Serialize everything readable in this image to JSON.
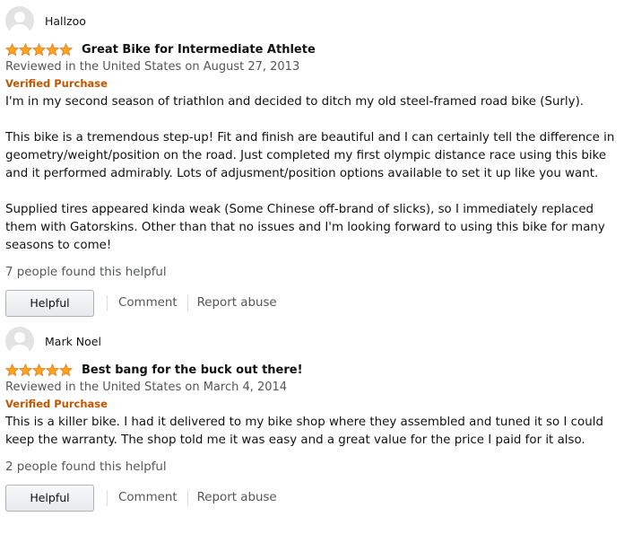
{
  "colors": {
    "star": "#ffa41c",
    "verified": "#c45500",
    "meta_text": "#555555"
  },
  "reviews": [
    {
      "author": "Hallzoo",
      "avatar_icon": "default-avatar-icon",
      "rating": 5,
      "title": "Great Bike for Intermediate Athlete",
      "date": "Reviewed in the United States on August 27, 2013",
      "verified": "Verified Purchase",
      "paragraphs": [
        "I'm in my second season of triathlon and decided to ditch my old steel-framed road bike (Surly).",
        "This bike is a tremendous step-up! Fit and finish are beautiful and I can certainly tell the difference in geometry/weight/position on the road. Just completed my first olympic distance race using this bike and it performed admirably. Lots of adjusment/position options available to set it up like you want.",
        "Supplied tires appeared kinda weak (Some Chinese off-brand of slicks), so I immediately replaced them with Gatorskins. Other than that no issues and I'm looking forward to using this bike for many seasons to come!"
      ],
      "helpful_count": "7 people found this helpful",
      "helpful_label": "Helpful",
      "comment_label": "Comment",
      "report_label": "Report abuse"
    },
    {
      "author": "Mark Noel",
      "avatar_icon": "default-avatar-icon",
      "rating": 5,
      "title": "Best bang for the buck out there!",
      "date": "Reviewed in the United States on March 4, 2014",
      "verified": "Verified Purchase",
      "paragraphs": [
        "This is a killer bike. I had it delivered to my bike shop where they assembled and tuned it so I could keep the warranty. The shop told me it was easy and a great value for the price I paid for it also."
      ],
      "helpful_count": "2 people found this helpful",
      "helpful_label": "Helpful",
      "comment_label": "Comment",
      "report_label": "Report abuse"
    }
  ]
}
